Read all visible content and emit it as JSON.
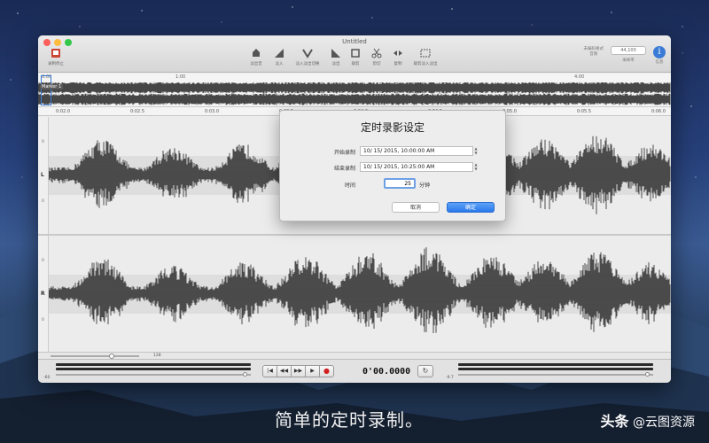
{
  "window": {
    "title": "Untitled"
  },
  "toolbar": {
    "left_label": "录制停止",
    "items": [
      "淡出音",
      "淡入",
      "淡入淡出切换",
      "淡出",
      "裁剪",
      "剪切",
      "复制",
      "裁剪淡入淡出"
    ],
    "rate_label": "采样率",
    "rate_value": "44,100",
    "rate_caption": "采样率",
    "info_label": "信息",
    "format_top": "未编码格式",
    "format_bottom": "音频"
  },
  "overview": {
    "marker": "Marker 1",
    "top_ticks": [
      "0:00",
      "1:00",
      "4:00"
    ],
    "bottom_ticks": [
      "0:02.0",
      "0:02.5",
      "0:03.0",
      "0:03.5",
      "0:04.0",
      "0:04.5",
      "0:05.0",
      "0:05.5",
      "0:06.0"
    ]
  },
  "tracks": {
    "left": {
      "label": "L",
      "top_tick": "0",
      "bottom_tick": "0"
    },
    "right": {
      "label": "R",
      "top_tick": "0",
      "bottom_tick": "0"
    }
  },
  "status": {
    "zoom_value": "128"
  },
  "transport": {
    "buttons": [
      "|◀",
      "◀◀",
      "▶▶",
      "▶",
      "●"
    ],
    "time": "0'00.0000",
    "left_level": "-60",
    "right_level": "-9.7"
  },
  "dialog": {
    "title": "定时录影设定",
    "start_label": "开始录制",
    "start_value": "10/ 15/ 2015, 10:00:00 AM",
    "end_label": "结束录制",
    "end_value": "10/ 15/ 2015, 10:25:00 AM",
    "duration_label": "时间",
    "duration_value": "25",
    "duration_unit": "分钟",
    "cancel": "取消",
    "ok": "确定"
  },
  "caption": "简单的定时录制。",
  "watermark": {
    "brand": "头条",
    "handle": "@云图资源"
  }
}
